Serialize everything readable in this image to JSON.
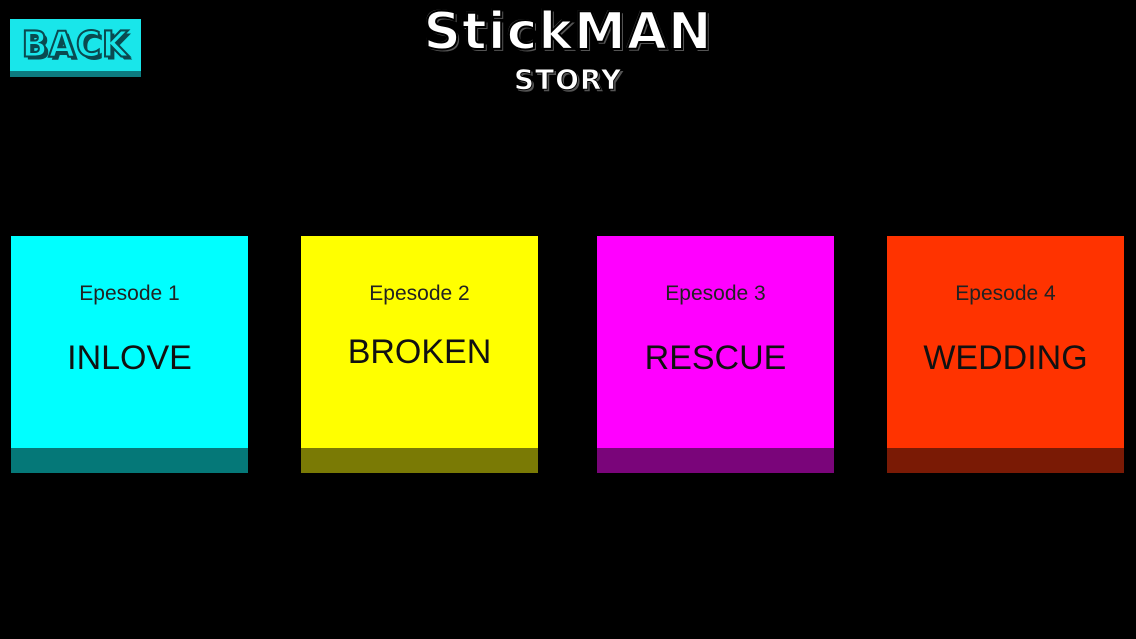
{
  "header": {
    "back_label": "BACK",
    "title": "StickMAN",
    "subtitle": "STORY"
  },
  "episodes": [
    {
      "number_label": "Epesode 1",
      "title": "INLOVE",
      "color": "#00ffff",
      "shadow_color": "#057878"
    },
    {
      "number_label": "Epesode 2",
      "title": "BROKEN",
      "color": "#ffff00",
      "shadow_color": "#7a7a05"
    },
    {
      "number_label": "Epesode 3",
      "title": "RESCUE",
      "color": "#ff00ff",
      "shadow_color": "#7a057a"
    },
    {
      "number_label": "Epesode 4",
      "title": "WEDDING",
      "color": "#ff3300",
      "shadow_color": "#7a1a05"
    }
  ],
  "colors": {
    "background": "#000000",
    "back_button": "#19e6ea"
  }
}
